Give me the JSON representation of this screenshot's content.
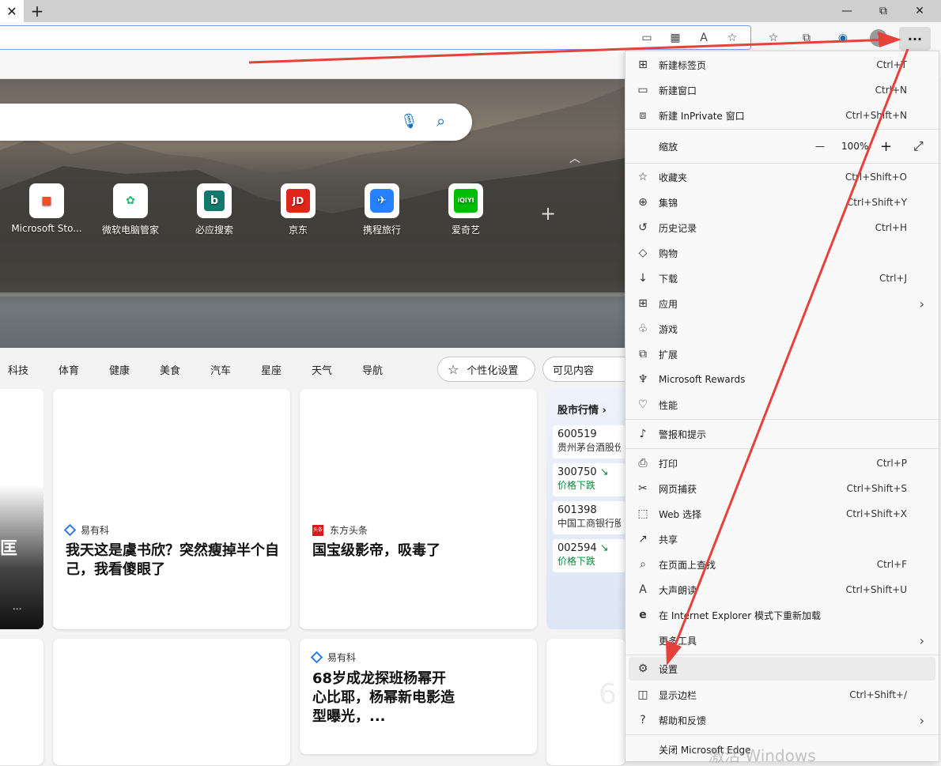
{
  "window": {
    "tab_close": "✕",
    "new_tab": "+",
    "minimize": "—",
    "restore": "⧉",
    "close": "✕"
  },
  "toolbar": {
    "more_label": "···"
  },
  "tiles": [
    {
      "label": "Microsoft Sto..."
    },
    {
      "label": "微软电脑管家"
    },
    {
      "label": "必应搜索",
      "glyph": "b"
    },
    {
      "label": "京东",
      "glyph": "JD"
    },
    {
      "label": "携程旅行"
    },
    {
      "label": "爱奇艺",
      "glyph": "iQIYI"
    }
  ],
  "nav": {
    "items": [
      "科技",
      "体育",
      "健康",
      "美食",
      "汽车",
      "星座",
      "天气",
      "导航"
    ],
    "personalize": "个性化设置",
    "visible_content": "可见内容"
  },
  "cards": {
    "left_card_text": "匡",
    "left_card_more": "...",
    "card1": {
      "source": "易有科",
      "headline": "我天这是虞书欣？突然瘦掉半个自己，我看傻眼了"
    },
    "card2": {
      "source": "东方头条",
      "source_badge": "头条",
      "headline": "国宝级影帝，吸毒了"
    },
    "card3": {
      "source": "易有科",
      "headline": "68岁成龙探班杨幂开心比耶，杨幂新电影造型曝光，..."
    },
    "right_bottom_text": "6"
  },
  "stock": {
    "title": "股市行情 ›",
    "items": [
      {
        "code": "600519",
        "sub": "贵州茅台酒股份"
      },
      {
        "code": "300750",
        "sub": "价格下跌",
        "trend": "↘"
      },
      {
        "code": "601398",
        "sub": "中国工商银行股"
      },
      {
        "code": "002594",
        "sub": "价格下跌",
        "trend": "↘"
      }
    ]
  },
  "menu": {
    "items": [
      {
        "label": "新建标签页",
        "shortcut": "Ctrl+T",
        "icon": "⊞"
      },
      {
        "label": "新建窗口",
        "shortcut": "Ctrl+N",
        "icon": "▭"
      },
      {
        "label": "新建 InPrivate 窗口",
        "shortcut": "Ctrl+Shift+N",
        "icon": "⧈"
      },
      {
        "label": "缩放"
      },
      {
        "label": "收藏夹",
        "shortcut": "Ctrl+Shift+O",
        "icon": "☆"
      },
      {
        "label": "集锦",
        "shortcut": "Ctrl+Shift+Y",
        "icon": "⊕"
      },
      {
        "label": "历史记录",
        "shortcut": "Ctrl+H",
        "icon": "↺"
      },
      {
        "label": "购物",
        "icon": "◇"
      },
      {
        "label": "下载",
        "shortcut": "Ctrl+J",
        "icon": "↓"
      },
      {
        "label": "应用",
        "icon": "⊞"
      },
      {
        "label": "游戏",
        "icon": "♧"
      },
      {
        "label": "扩展",
        "icon": "⧉"
      },
      {
        "label": "Microsoft Rewards",
        "icon": "♆"
      },
      {
        "label": "性能",
        "icon": "♡"
      },
      {
        "label": "警报和提示",
        "icon": "♪"
      },
      {
        "label": "打印",
        "shortcut": "Ctrl+P",
        "icon": "⎙"
      },
      {
        "label": "网页捕获",
        "shortcut": "Ctrl+Shift+S",
        "icon": "✂"
      },
      {
        "label": "Web 选择",
        "shortcut": "Ctrl+Shift+X",
        "icon": "⬚"
      },
      {
        "label": "共享",
        "icon": "↗"
      },
      {
        "label": "在页面上查找",
        "shortcut": "Ctrl+F",
        "icon": "⌕"
      },
      {
        "label": "大声朗读",
        "shortcut": "Ctrl+Shift+U",
        "icon": "A"
      },
      {
        "label": "在 Internet Explorer 模式下重新加载",
        "icon": "e"
      },
      {
        "label": "更多工具"
      },
      {
        "label": "设置",
        "icon": "⚙"
      },
      {
        "label": "显示边栏",
        "shortcut": "Ctrl+Shift+/",
        "icon": "◫"
      },
      {
        "label": "帮助和反馈",
        "icon": "?"
      },
      {
        "label": "关闭 Microsoft Edge"
      }
    ],
    "zoom": {
      "value": "100%",
      "minus": "—",
      "plus": "+",
      "fullscreen": "⤢"
    }
  },
  "watermark": "激活 Windows",
  "colors": {
    "annotation_arrow": "#e8403a",
    "accent": "#0f6cbd"
  }
}
